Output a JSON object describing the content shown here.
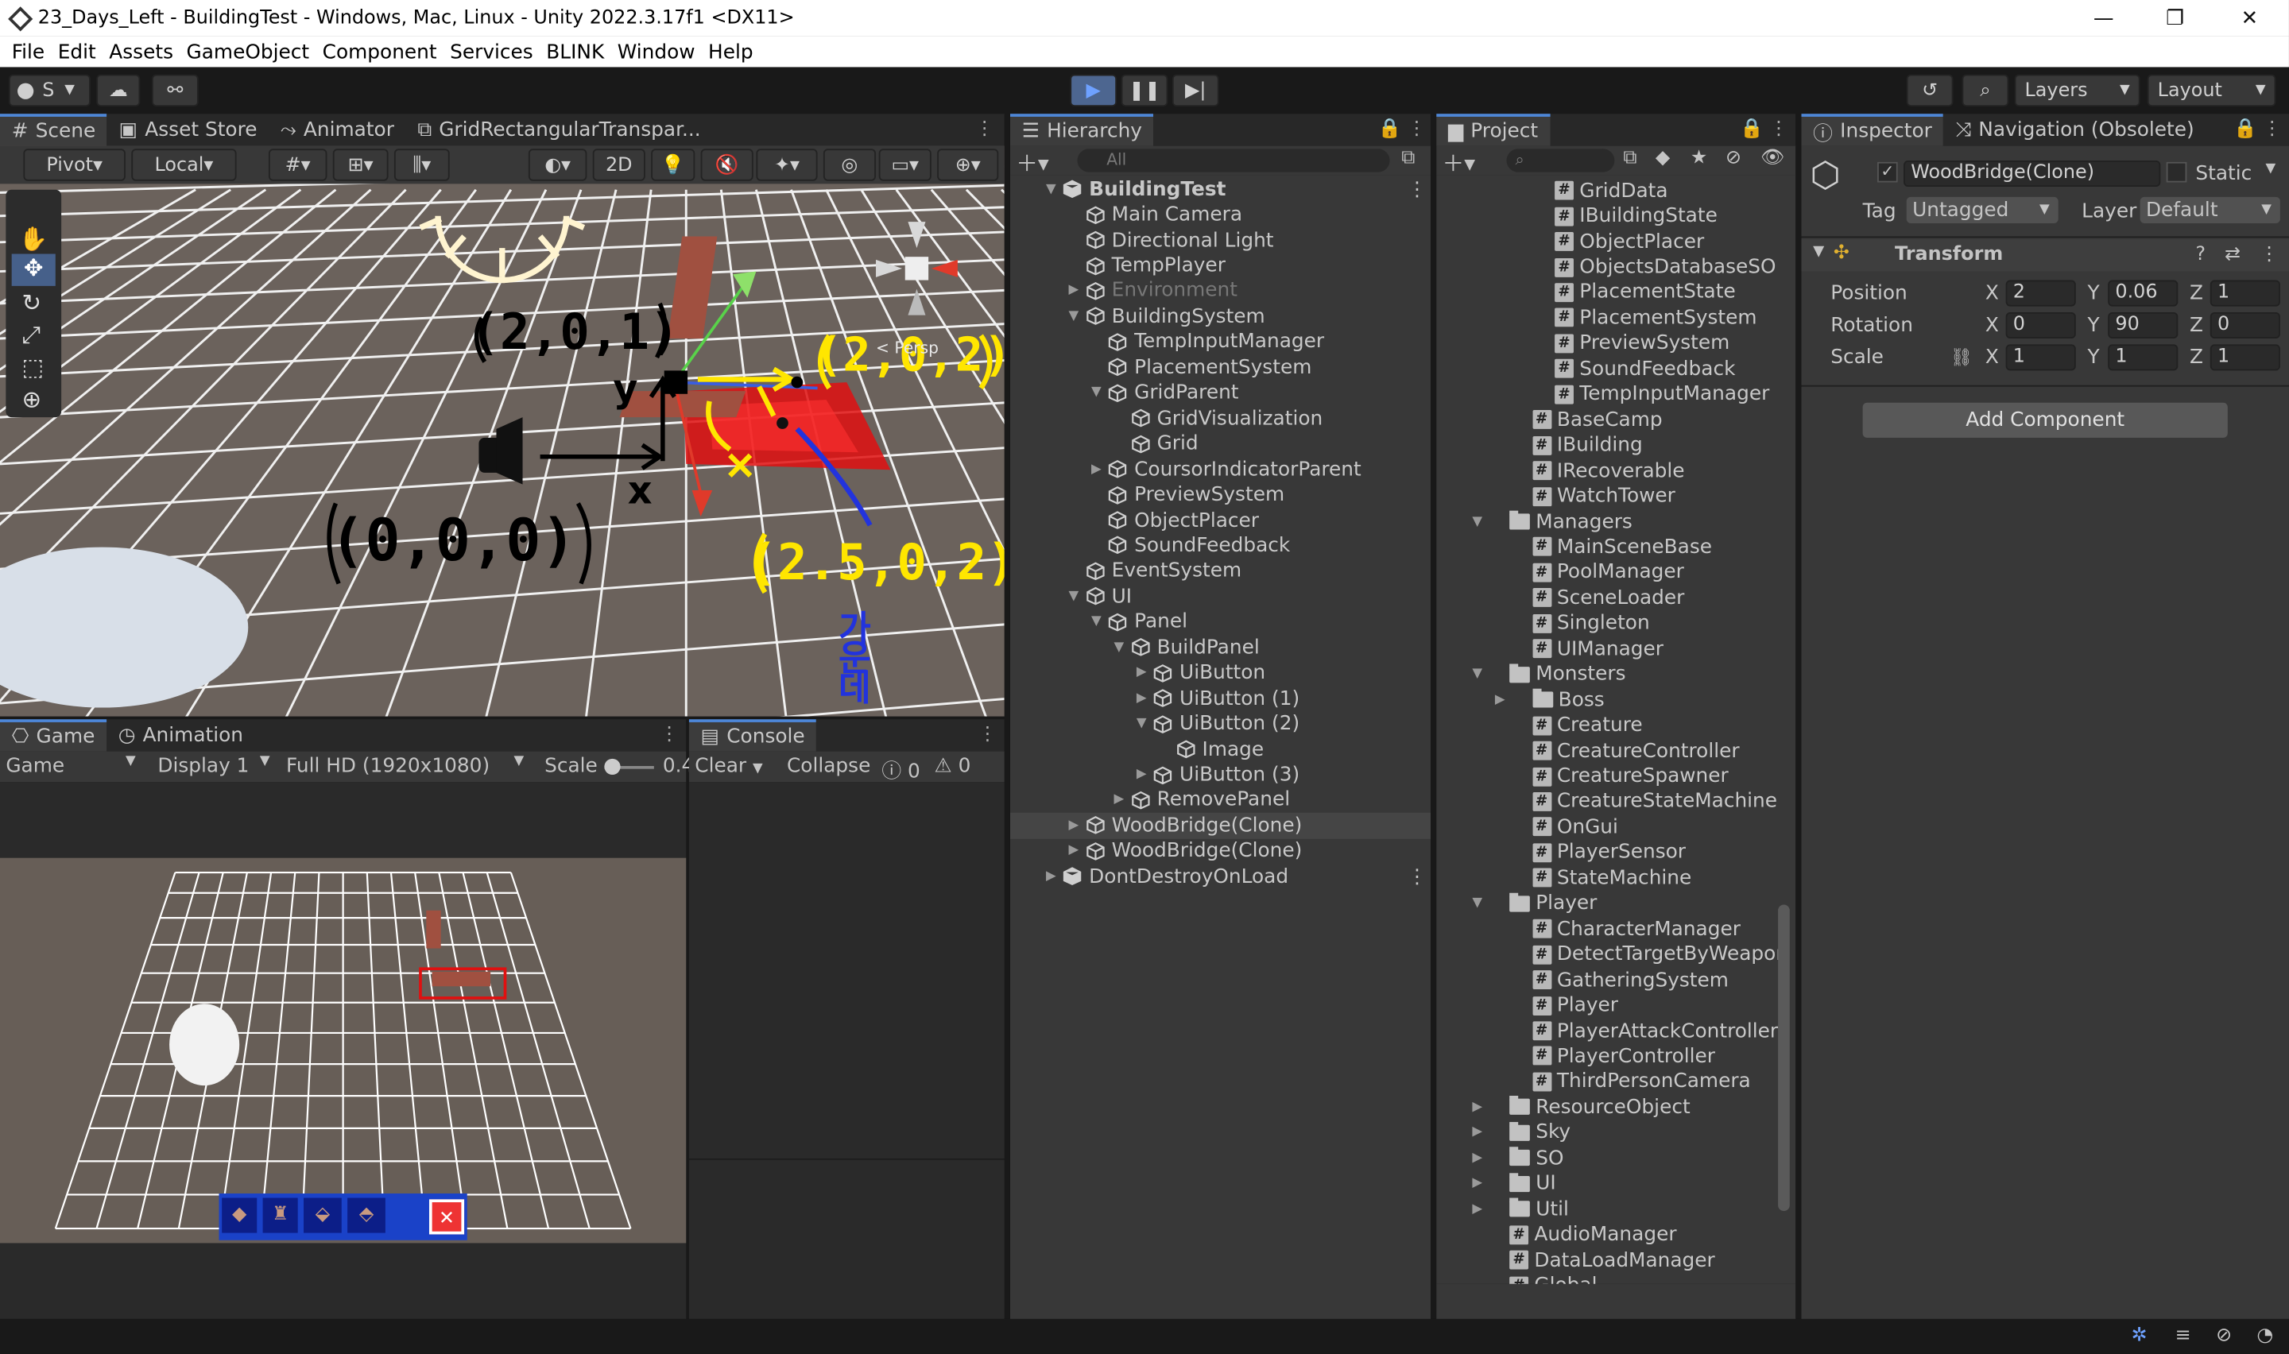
{
  "window": {
    "title": "23_Days_Left - BuildingTest - Windows, Mac, Linux - Unity 2022.3.17f1 <DX11>"
  },
  "menu": [
    "File",
    "Edit",
    "Assets",
    "GameObject",
    "Component",
    "Services",
    "BLINK",
    "Window",
    "Help"
  ],
  "toolbar": {
    "account": "S",
    "layers": "Layers",
    "layout": "Layout"
  },
  "scene_tabs": [
    "Scene",
    "Asset Store",
    "Animator",
    "GridRectangularTranspar..."
  ],
  "scene_tools": {
    "pivot": "Pivot",
    "local": "Local",
    "mode2d": "2D",
    "gizmo_persp": "< Persp"
  },
  "annotations": {
    "a1": "(2,0,1)",
    "a2": "(2,0,2)",
    "a3": "(0,0,0)",
    "a4": "(2.5,0,2)",
    "a5": "가 운 데",
    "xlabel": "x",
    "ylabel": "y"
  },
  "game_tabs": [
    "Game",
    "Animation"
  ],
  "game_toolbar": {
    "mode": "Game",
    "display": "Display 1",
    "resolution": "Full HD (1920x1080)",
    "scale_label": "Scale",
    "scale_value": "0.4"
  },
  "console": {
    "tab": "Console",
    "clear": "Clear",
    "collapse": "Collapse",
    "count1": "0",
    "count2": "0"
  },
  "hierarchy": {
    "tab": "Hierarchy",
    "search": "All",
    "rows": [
      {
        "t": "BuildingTest",
        "d": 0,
        "a": "▼",
        "bold": true
      },
      {
        "t": "Main Camera",
        "d": 1,
        "a": ""
      },
      {
        "t": "Directional Light",
        "d": 1,
        "a": ""
      },
      {
        "t": "TempPlayer",
        "d": 1,
        "a": ""
      },
      {
        "t": "Environment",
        "d": 1,
        "a": "▶",
        "dim": true
      },
      {
        "t": "BuildingSystem",
        "d": 1,
        "a": "▼"
      },
      {
        "t": "TempInputManager",
        "d": 2,
        "a": ""
      },
      {
        "t": "PlacementSystem",
        "d": 2,
        "a": ""
      },
      {
        "t": "GridParent",
        "d": 2,
        "a": "▼"
      },
      {
        "t": "GridVisualization",
        "d": 3,
        "a": ""
      },
      {
        "t": "Grid",
        "d": 3,
        "a": ""
      },
      {
        "t": "CoursorIndicatorParent",
        "d": 2,
        "a": "▶"
      },
      {
        "t": "PreviewSystem",
        "d": 2,
        "a": ""
      },
      {
        "t": "ObjectPlacer",
        "d": 2,
        "a": ""
      },
      {
        "t": "SoundFeedback",
        "d": 2,
        "a": ""
      },
      {
        "t": "EventSystem",
        "d": 1,
        "a": ""
      },
      {
        "t": "UI",
        "d": 1,
        "a": "▼"
      },
      {
        "t": "Panel",
        "d": 2,
        "a": "▼"
      },
      {
        "t": "BuildPanel",
        "d": 3,
        "a": "▼"
      },
      {
        "t": "UiButton",
        "d": 4,
        "a": "▶"
      },
      {
        "t": "UiButton (1)",
        "d": 4,
        "a": "▶"
      },
      {
        "t": "UiButton (2)",
        "d": 4,
        "a": "▼"
      },
      {
        "t": "Image",
        "d": 5,
        "a": ""
      },
      {
        "t": "UiButton (3)",
        "d": 4,
        "a": "▶"
      },
      {
        "t": "RemovePanel",
        "d": 3,
        "a": "▶"
      },
      {
        "t": "WoodBridge(Clone)",
        "d": 1,
        "a": "▶",
        "sel": true
      },
      {
        "t": "WoodBridge(Clone)",
        "d": 1,
        "a": "▶"
      },
      {
        "t": "DontDestroyOnLoad",
        "d": 0,
        "a": "▶"
      }
    ]
  },
  "project": {
    "tab": "Project",
    "rows": [
      {
        "t": "GridData",
        "d": 2,
        "k": "s"
      },
      {
        "t": "IBuildingState",
        "d": 2,
        "k": "s"
      },
      {
        "t": "ObjectPlacer",
        "d": 2,
        "k": "s"
      },
      {
        "t": "ObjectsDatabaseSO",
        "d": 2,
        "k": "s"
      },
      {
        "t": "PlacementState",
        "d": 2,
        "k": "s"
      },
      {
        "t": "PlacementSystem",
        "d": 2,
        "k": "s"
      },
      {
        "t": "PreviewSystem",
        "d": 2,
        "k": "s"
      },
      {
        "t": "SoundFeedback",
        "d": 2,
        "k": "s"
      },
      {
        "t": "TempInputManager",
        "d": 2,
        "k": "s"
      },
      {
        "t": "BaseCamp",
        "d": 1,
        "k": "s"
      },
      {
        "t": "IBuilding",
        "d": 1,
        "k": "s"
      },
      {
        "t": "IRecoverable",
        "d": 1,
        "k": "s"
      },
      {
        "t": "WatchTower",
        "d": 1,
        "k": "s"
      },
      {
        "t": "Managers",
        "d": 0,
        "k": "f",
        "a": "▼"
      },
      {
        "t": "MainSceneBase",
        "d": 1,
        "k": "s"
      },
      {
        "t": "PoolManager",
        "d": 1,
        "k": "s"
      },
      {
        "t": "SceneLoader",
        "d": 1,
        "k": "s"
      },
      {
        "t": "Singleton",
        "d": 1,
        "k": "s"
      },
      {
        "t": "UIManager",
        "d": 1,
        "k": "s"
      },
      {
        "t": "Monsters",
        "d": 0,
        "k": "f",
        "a": "▼"
      },
      {
        "t": "Boss",
        "d": 1,
        "k": "f",
        "a": "▶"
      },
      {
        "t": "Creature",
        "d": 1,
        "k": "s"
      },
      {
        "t": "CreatureController",
        "d": 1,
        "k": "s"
      },
      {
        "t": "CreatureSpawner",
        "d": 1,
        "k": "s"
      },
      {
        "t": "CreatureStateMachine",
        "d": 1,
        "k": "s"
      },
      {
        "t": "OnGui",
        "d": 1,
        "k": "s"
      },
      {
        "t": "PlayerSensor",
        "d": 1,
        "k": "s"
      },
      {
        "t": "StateMachine",
        "d": 1,
        "k": "s"
      },
      {
        "t": "Player",
        "d": 0,
        "k": "f",
        "a": "▼"
      },
      {
        "t": "CharacterManager",
        "d": 1,
        "k": "s"
      },
      {
        "t": "DetectTargetByWeapon",
        "d": 1,
        "k": "s"
      },
      {
        "t": "GatheringSystem",
        "d": 1,
        "k": "s"
      },
      {
        "t": "Player",
        "d": 1,
        "k": "s"
      },
      {
        "t": "PlayerAttackController",
        "d": 1,
        "k": "s"
      },
      {
        "t": "PlayerController",
        "d": 1,
        "k": "s"
      },
      {
        "t": "ThirdPersonCamera",
        "d": 1,
        "k": "s"
      },
      {
        "t": "ResourceObject",
        "d": 0,
        "k": "f",
        "a": "▶"
      },
      {
        "t": "Sky",
        "d": 0,
        "k": "f",
        "a": "▶"
      },
      {
        "t": "SO",
        "d": 0,
        "k": "f",
        "a": "▶"
      },
      {
        "t": "UI",
        "d": 0,
        "k": "f",
        "a": "▶"
      },
      {
        "t": "Util",
        "d": 0,
        "k": "f",
        "a": "▶"
      },
      {
        "t": "AudioManager",
        "d": 0,
        "k": "s"
      },
      {
        "t": "DataLoadManager",
        "d": 0,
        "k": "s"
      },
      {
        "t": "Global",
        "d": 0,
        "k": "s"
      }
    ]
  },
  "inspector": {
    "tab": "Inspector",
    "tab2": "Navigation (Obsolete)",
    "name": "WoodBridge(Clone)",
    "static": "Static",
    "tag_label": "Tag",
    "tag": "Untagged",
    "layer_label": "Layer",
    "layer": "Default",
    "component": "Transform",
    "position_label": "Position",
    "rotation_label": "Rotation",
    "scale_label": "Scale",
    "pos": {
      "x": "2",
      "y": "0.06",
      "z": "1"
    },
    "rot": {
      "x": "0",
      "y": "90",
      "z": "0"
    },
    "scl": {
      "x": "1",
      "y": "1",
      "z": "1"
    },
    "add_component": "Add Component"
  },
  "colors": {
    "accent": "#4d87d8",
    "annotation_yellow": "#ffe600",
    "annotation_blue": "#2233dd",
    "placement_red": "#e01010"
  }
}
